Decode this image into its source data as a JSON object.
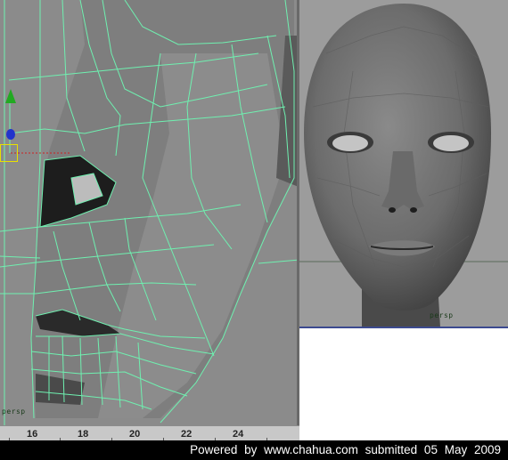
{
  "viewports": {
    "left": {
      "label": "persp"
    },
    "right": {
      "label": "persp"
    }
  },
  "timeline": {
    "ticks": [
      "16",
      "18",
      "20",
      "22",
      "24"
    ]
  },
  "caption": {
    "text": "Powered by www.chahua.com submitted 05 May 2009"
  },
  "colors": {
    "wireframe": "#6ff0b0",
    "face_shade": "#808080",
    "manipulator_y": "#22aa22",
    "manipulator_z": "#2233cc",
    "manipulator_x": "#cc2222",
    "selection_box": "#e8e000"
  },
  "icons": {
    "y_axis": "move-y-arrow-icon",
    "z_axis": "move-z-handle-icon",
    "pivot": "pivot-square-icon"
  }
}
